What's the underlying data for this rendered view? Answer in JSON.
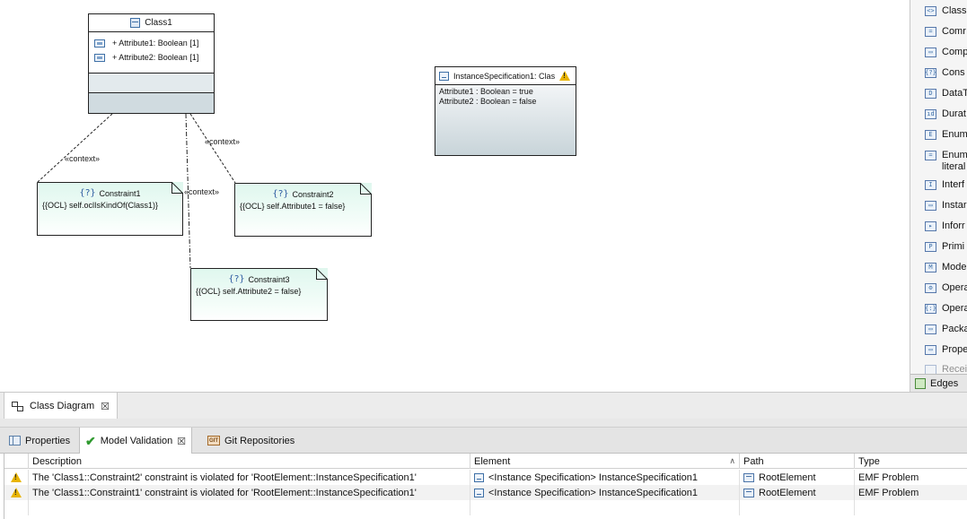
{
  "diagram": {
    "class1": {
      "name": "Class1",
      "attributes": [
        "+ Attribute1: Boolean [1]",
        "+ Attribute2: Boolean [1]"
      ]
    },
    "constraints": [
      {
        "name": "Constraint1",
        "body": "{{OCL} self.oclIsKindOf(Class1)}",
        "icon": "{?}"
      },
      {
        "name": "Constraint2",
        "body": "{{OCL} self.Attribute1 = false}",
        "icon": "{?}"
      },
      {
        "name": "Constraint3",
        "body": "{{OCL} self.Attribute2 = false}",
        "icon": "{?}"
      }
    ],
    "context_label": "«context»",
    "instance": {
      "title": "InstanceSpecification1: Clas",
      "slots": [
        "Attribute1 : Boolean = true",
        "Attribute2 : Boolean = false"
      ]
    }
  },
  "palette": {
    "items": [
      {
        "label": "Class",
        "icon": "<>"
      },
      {
        "label": "Comr",
        "icon": "="
      },
      {
        "label": "Comp",
        "icon": "▭"
      },
      {
        "label": "Cons",
        "icon": "{?}"
      },
      {
        "label": "DataT",
        "icon": "D"
      },
      {
        "label": "Durat",
        "icon": "ıd"
      },
      {
        "label": "Enum",
        "icon": "E"
      },
      {
        "label": "Enum",
        "icon": "="
      },
      {
        "label": "literal",
        "icon": ""
      },
      {
        "label": "Interf",
        "icon": "I"
      },
      {
        "label": "Instar",
        "icon": "▭"
      },
      {
        "label": "Inforr",
        "icon": "▸"
      },
      {
        "label": "Primi",
        "icon": "P"
      },
      {
        "label": "Mode",
        "icon": "M"
      },
      {
        "label": "Opera",
        "icon": "⚙"
      },
      {
        "label": "Opera",
        "icon": "{:}"
      },
      {
        "label": "Packa",
        "icon": "▭"
      },
      {
        "label": "Prope",
        "icon": "▭"
      },
      {
        "label": "Recei",
        "icon": ""
      }
    ],
    "edges_label": "Edges"
  },
  "editor_tab": {
    "label": "Class Diagram"
  },
  "panel": {
    "tabs": [
      {
        "label": "Properties"
      },
      {
        "label": "Model Validation"
      },
      {
        "label": "Git Repositories"
      }
    ],
    "git_icon_text": "GIT",
    "columns": [
      "Description",
      "Element",
      "Path",
      "Type"
    ],
    "rows": [
      {
        "description": "The 'Class1::Constraint2' constraint is violated for 'RootElement::InstanceSpecification1'",
        "element": "<Instance Specification> InstanceSpecification1",
        "path": "RootElement",
        "type": "EMF Problem"
      },
      {
        "description": "The 'Class1::Constraint1' constraint is violated for 'RootElement::InstanceSpecification1'",
        "element": "<Instance Specification> InstanceSpecification1",
        "path": "RootElement",
        "type": "EMF Problem"
      }
    ]
  },
  "colors": {
    "note_fill": "#dff7ee",
    "class_fill": "#c9d5da",
    "warning": "#e8b400",
    "valid_check": "#2f9a2f"
  }
}
